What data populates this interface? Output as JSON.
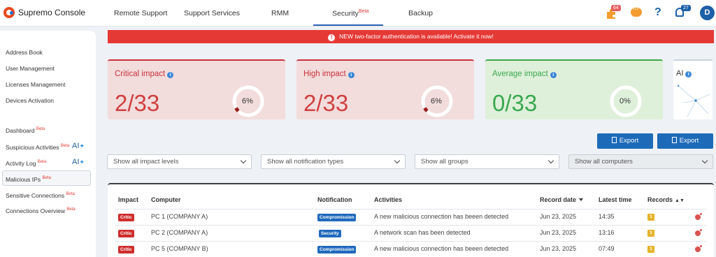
{
  "app": {
    "title": "Supremo Console"
  },
  "nav": {
    "tabs": [
      {
        "label": "Remote Support"
      },
      {
        "label": "Support Services"
      },
      {
        "label": "RMM"
      },
      {
        "label": "Security",
        "badge": "Beta"
      },
      {
        "label": "Backup"
      }
    ],
    "active_tab": "Security"
  },
  "top_icons": {
    "extensions_badge": "64",
    "notifications_badge": "27",
    "avatar_initial": "D"
  },
  "sidebar": {
    "items": [
      {
        "label": "Address Book"
      },
      {
        "label": "User Management"
      },
      {
        "label": "Licenses Management"
      },
      {
        "label": "Devices Activation"
      },
      {
        "label": "Dashboard",
        "badge": "Beta"
      },
      {
        "label": "Suspicious Activities",
        "badge": "Beta",
        "ai": "AI",
        "active": true
      },
      {
        "label": "Activity Log",
        "badge": "Beta",
        "ai": "AI"
      },
      {
        "label": "Malicious IPs",
        "badge": "Beta"
      },
      {
        "label": "Sensitive Connections",
        "badge": "Beta"
      },
      {
        "label": "Connections Overview",
        "badge": "Beta"
      }
    ]
  },
  "alert": {
    "text": "NEW two-factor authentication is available! Activate it now!",
    "icon": "exclamation-icon"
  },
  "cards": [
    {
      "title": "Critical impact",
      "value": "2/33",
      "gauge_label": "6%",
      "gauge_fraction": 0.06,
      "color": "#d04040"
    },
    {
      "title": "High impact",
      "value": "2/33",
      "gauge_label": "6%",
      "gauge_fraction": 0.06,
      "color": "#d04040"
    },
    {
      "title": "Average impact",
      "value": "0/33",
      "gauge_label": "0%",
      "gauge_fraction": 0,
      "color": "#3aa84f"
    }
  ],
  "ai_card": {
    "title": "AI"
  },
  "export_buttons": [
    {
      "label": "Export"
    },
    {
      "label": "Export"
    }
  ],
  "filters": [
    {
      "value": "Show all impact levels"
    },
    {
      "value": "Show all notification types"
    },
    {
      "value": "Show all groups"
    },
    {
      "value": "Show all computers",
      "disabled": true
    }
  ],
  "table": {
    "headers": {
      "impact": "Impact",
      "computer": "Computer",
      "notification": "Notification",
      "activities": "Activities",
      "record_date": "Record date",
      "latest_time": "Latest time",
      "records": "Records"
    },
    "rows": [
      {
        "impact": "Critic",
        "computer": "PC 1 (COMPANY A)",
        "notification": "Compromission",
        "activity": "A new malicious connection has beeen detected",
        "date": "Jun 23, 2025",
        "time": "14:35",
        "records": "1"
      },
      {
        "impact": "Critic",
        "computer": "PC 2 (COMPANY A)",
        "notification": "Security",
        "activity": "A network scan has been detected",
        "date": "Jun 23, 2025",
        "time": "13:16",
        "records": "1"
      },
      {
        "impact": "Critic",
        "computer": "PC 5 (COMPANY B)",
        "notification": "Compromission",
        "activity": "A new malicious connection has beeen detected",
        "date": "Jun 23, 2025",
        "time": "07:49",
        "records": "1"
      }
    ]
  },
  "colors": {
    "accent": "#1d6ab8",
    "danger": "#e53935",
    "success": "#3aa84f",
    "warning": "#e7b22c"
  }
}
